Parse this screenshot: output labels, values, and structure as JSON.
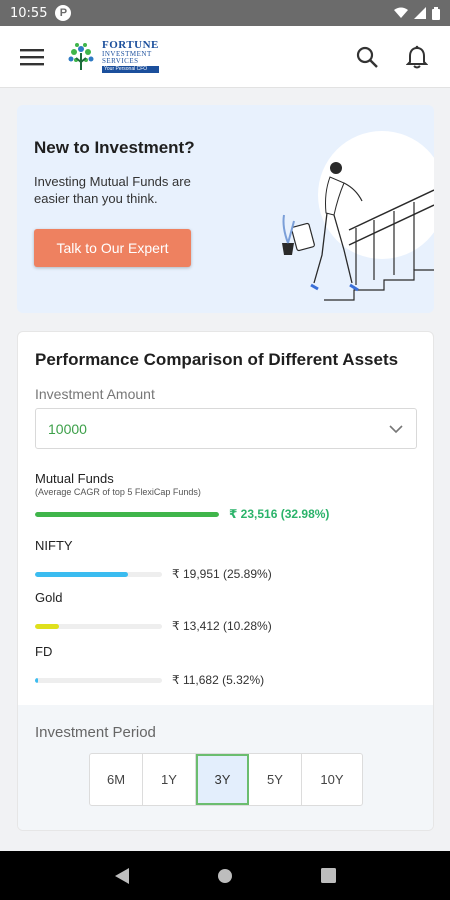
{
  "status_bar": {
    "time": "10:55",
    "app_badge": "P"
  },
  "app_bar": {
    "logo": {
      "line1": "FORTUNE",
      "line2": "INVESTMENT",
      "line3": "SERVICES",
      "line4": "Your Personal CFO"
    },
    "icons": [
      "menu-icon",
      "search-icon",
      "bell-icon"
    ]
  },
  "hero": {
    "title": "New to Investment?",
    "subtitle": "Investing Mutual Funds are easier than you think.",
    "cta": "Talk to Our Expert",
    "cta_color": "#ee8160",
    "background": "#e8f1fd"
  },
  "performance": {
    "title": "Performance Comparison of Different Assets",
    "amount_label": "Investment Amount",
    "amount_value": "10000",
    "assets": [
      {
        "name": "Mutual Funds",
        "note": "(Average CAGR of top 5 FlexiCap Funds)",
        "value": "₹ 23,516 (32.98%)",
        "fill": 1.0,
        "color": "#3fb54a",
        "track": 183
      },
      {
        "name": "NIFTY",
        "value": "₹ 19,951 (25.89%)",
        "fill": 0.73,
        "color": "#3bbcf0",
        "track": 127
      },
      {
        "name": "Gold",
        "value": "₹ 13,412 (10.28%)",
        "fill": 0.19,
        "color": "#dfe01c",
        "track": 127
      },
      {
        "name": "FD",
        "value": "₹ 11,682 (5.32%)",
        "fill": 0.02,
        "color": "#3bbcf0",
        "track": 127
      }
    ],
    "period_label": "Investment Period",
    "periods": [
      "6M",
      "1Y",
      "3Y",
      "5Y",
      "10Y"
    ],
    "selected_period": "3Y"
  }
}
